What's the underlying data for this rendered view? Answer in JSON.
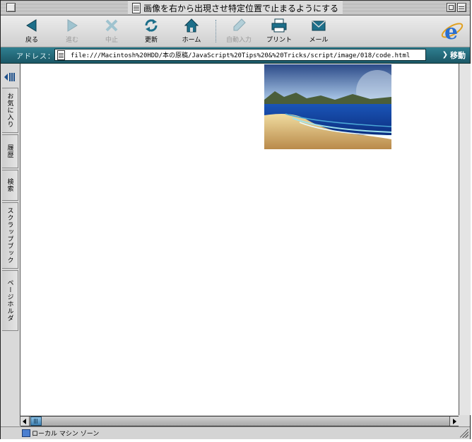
{
  "window": {
    "title": "画像を右から出現させ特定位置で止まるようにする"
  },
  "toolbar": {
    "buttons": [
      {
        "id": "back",
        "label": "戻る",
        "enabled": true,
        "icon": "back-arrow-icon"
      },
      {
        "id": "forward",
        "label": "進む",
        "enabled": false,
        "icon": "forward-arrow-icon"
      },
      {
        "id": "stop",
        "label": "中止",
        "enabled": false,
        "icon": "stop-x-icon"
      },
      {
        "id": "refresh",
        "label": "更新",
        "enabled": true,
        "icon": "refresh-icon"
      },
      {
        "id": "home",
        "label": "ホーム",
        "enabled": true,
        "icon": "home-icon"
      },
      {
        "id": "autofill",
        "label": "自動入力",
        "enabled": false,
        "icon": "pen-icon"
      },
      {
        "id": "print",
        "label": "プリント",
        "enabled": true,
        "icon": "printer-icon"
      },
      {
        "id": "mail",
        "label": "メール",
        "enabled": true,
        "icon": "mail-icon"
      }
    ],
    "logo": "ie-logo-icon"
  },
  "address": {
    "label": "アドレス：",
    "url": "file:///Macintosh%20HDD/本の原稿/JavaScript%20Tips%20&%20Tricks/script/image/018/code.html",
    "go_label": "移動"
  },
  "sidebar": {
    "tabs": [
      "お気に入り",
      "履歴",
      "検索",
      "スクラップブック",
      "ページホルダ"
    ]
  },
  "status": {
    "zone": "ローカル マシン ゾーン"
  },
  "colors": {
    "address_bar": "#1b5766",
    "toolbar_icon": "#1d6f8a",
    "scroll_thumb": "#3f82b4"
  }
}
